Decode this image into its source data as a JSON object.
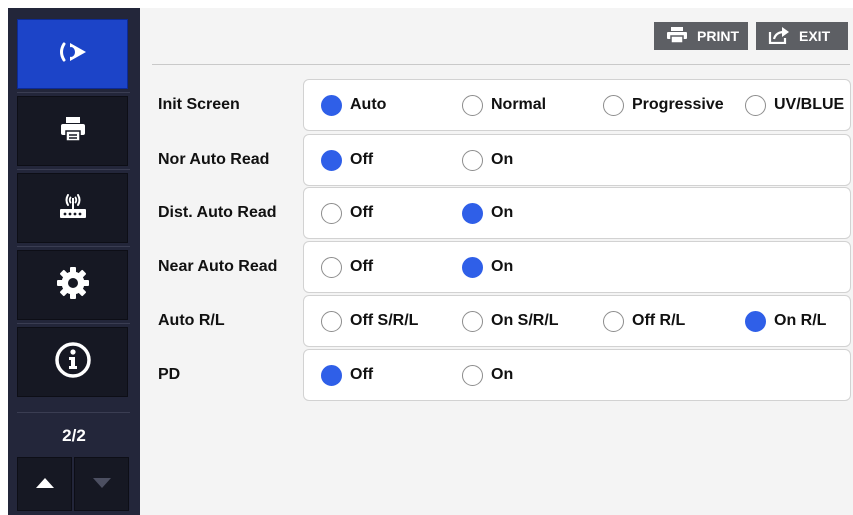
{
  "sidebar": {
    "items": [
      {
        "icon": "eye-logo-icon",
        "active": true
      },
      {
        "icon": "printer-icon",
        "active": false
      },
      {
        "icon": "wireless-router-icon",
        "active": false
      },
      {
        "icon": "gear-icon",
        "active": false
      },
      {
        "icon": "info-icon",
        "active": false
      }
    ],
    "page_indicator": "2/2",
    "up_icon": "arrow-up-icon",
    "down_icon": "arrow-down-icon"
  },
  "toolbar": {
    "print_label": "PRINT",
    "print_icon": "printer-icon",
    "exit_label": "EXIT",
    "exit_icon": "share-exit-icon"
  },
  "settings": [
    {
      "label": "Init Screen",
      "options": [
        "Auto",
        "Normal",
        "Progressive",
        "UV/BLUE"
      ],
      "selected": 0
    },
    {
      "label": "Nor Auto Read",
      "options": [
        "Off",
        "On"
      ],
      "selected": 0
    },
    {
      "label": "Dist. Auto Read",
      "options": [
        "Off",
        "On"
      ],
      "selected": 1
    },
    {
      "label": "Near Auto Read",
      "options": [
        "Off",
        "On"
      ],
      "selected": 1
    },
    {
      "label": "Auto R/L",
      "options": [
        "Off S/R/L",
        "On S/R/L",
        "Off R/L",
        "On R/L"
      ],
      "selected": 3
    },
    {
      "label": "PD",
      "options": [
        "Off",
        "On"
      ],
      "selected": 0
    }
  ],
  "colors": {
    "accent": "#2f5fe8",
    "sidebar_bg": "#23263a",
    "nav_active": "#1c44c8",
    "toolbar_button": "#5d5f64"
  }
}
